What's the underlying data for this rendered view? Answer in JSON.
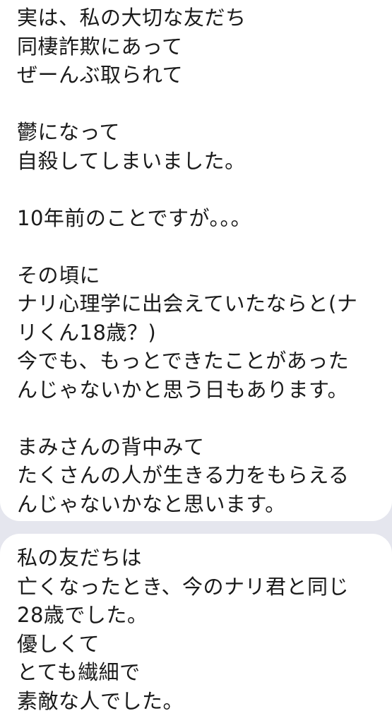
{
  "messages": [
    {
      "lines": [
        "実は、私の大切な友だち",
        "同棲詐欺にあって",
        "ぜーんぶ取られて",
        "",
        "鬱になって",
        "自殺してしまいました。",
        "",
        "10年前のことですが。。。",
        "",
        "その頃に",
        "ナリ心理学に出会えていたならと(ナ",
        "リくん18歳？)",
        "今でも、もっとできたことがあった",
        "んじゃないかと思う日もあります。",
        "",
        "まみさんの背中みて",
        "たくさんの人が生きる力をもらえる",
        "んじゃないかなと思います。"
      ]
    },
    {
      "lines": [
        "私の友だちは",
        "亡くなったとき、今のナリ君と同じ",
        "28歳でした。",
        "優しくて",
        "とても繊細で",
        "素敵な人でした。"
      ]
    }
  ]
}
